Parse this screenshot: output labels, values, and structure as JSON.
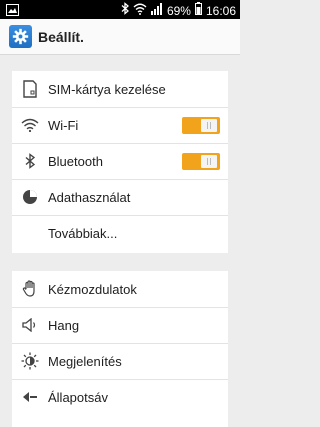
{
  "status_bar": {
    "battery_percent": "69%",
    "time": "16:06",
    "icons": [
      "image-icon",
      "bluetooth-icon",
      "wifi-icon",
      "signal-icon",
      "battery-icon"
    ]
  },
  "action_bar": {
    "title": "Beállít.",
    "icon": "settings-gear-icon"
  },
  "section1": {
    "items": [
      {
        "label": "SIM-kártya kezelése",
        "icon": "sim-card-icon"
      },
      {
        "label": "Wi-Fi",
        "icon": "wifi-icon",
        "toggle": "on"
      },
      {
        "label": "Bluetooth",
        "icon": "bluetooth-icon",
        "toggle": "on"
      },
      {
        "label": "Adathasználat",
        "icon": "data-usage-icon"
      },
      {
        "label": "Továbbiak...",
        "icon": ""
      }
    ]
  },
  "section2": {
    "items": [
      {
        "label": "Kézmozdulatok",
        "icon": "hand-gesture-icon"
      },
      {
        "label": "Hang",
        "icon": "speaker-icon"
      },
      {
        "label": "Megjelenítés",
        "icon": "brightness-icon"
      },
      {
        "label": "Állapotsáv",
        "icon": "status-bar-icon"
      }
    ]
  },
  "colors": {
    "toggle_on": "#f2a31c",
    "background": "#ededed",
    "status_bar": "#000000"
  }
}
